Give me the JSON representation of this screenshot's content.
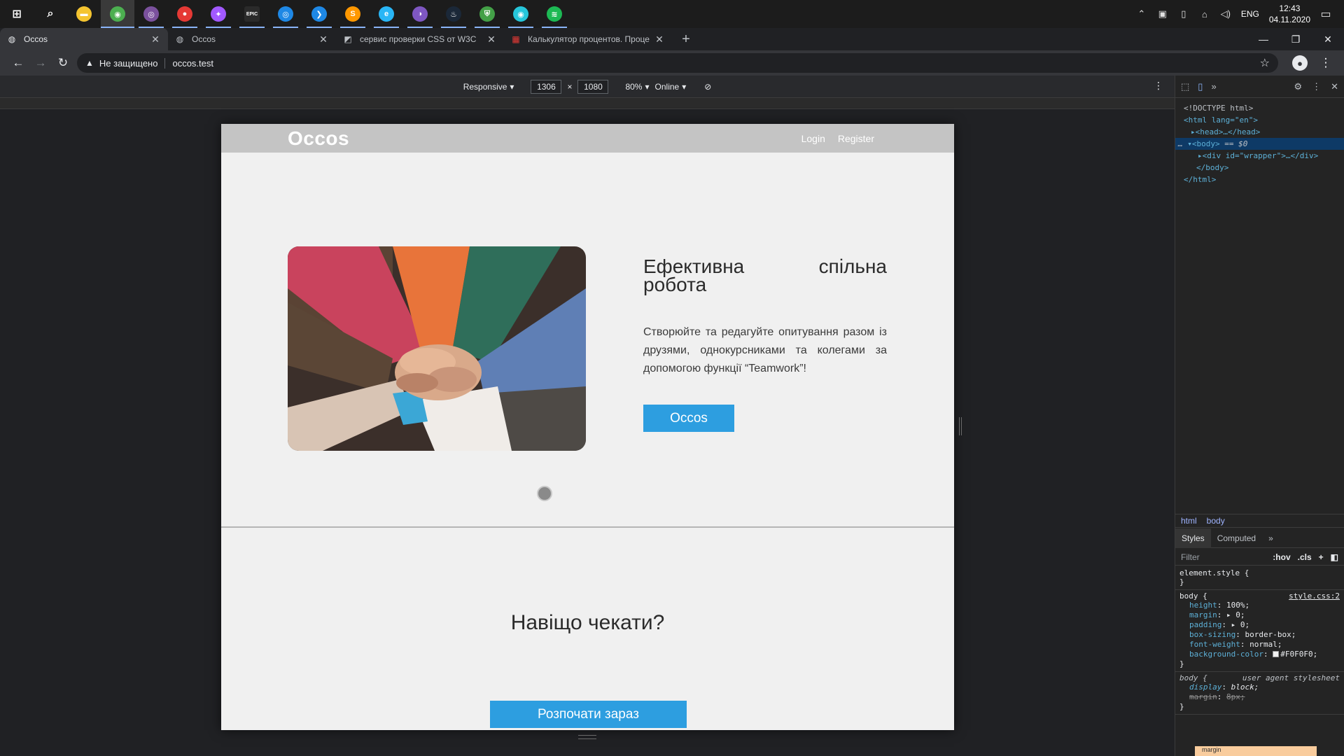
{
  "taskbar": {
    "apps": [
      {
        "name": "windows-start-icon",
        "glyph": "⊞",
        "color": "#ffffff"
      },
      {
        "name": "search-icon",
        "glyph": "⌕",
        "color": "#ffffff"
      },
      {
        "name": "file-explorer-icon",
        "glyph": "▬",
        "color": "#f4c430"
      },
      {
        "name": "chrome-icon",
        "glyph": "◉",
        "color": "#4caf50"
      },
      {
        "name": "viber-icon",
        "glyph": "◎",
        "color": "#7b519d"
      },
      {
        "name": "colorful-app-icon",
        "glyph": "●",
        "color": "#e53935"
      },
      {
        "name": "figma-icon",
        "glyph": "✦",
        "color": "#a259ff"
      },
      {
        "name": "epic-games-icon",
        "glyph": "EPIC",
        "color": "#2a2a2a"
      },
      {
        "name": "app-swirl-icon",
        "glyph": "◎",
        "color": "#1e88e5"
      },
      {
        "name": "vscode-icon",
        "glyph": "❯",
        "color": "#1e88e5"
      },
      {
        "name": "sublime-text-icon",
        "glyph": "S",
        "color": "#ff9800"
      },
      {
        "name": "edge-icon",
        "glyph": "e",
        "color": "#29b6f6"
      },
      {
        "name": "tor-browser-icon",
        "glyph": "◑",
        "color": "#7e57c2"
      },
      {
        "name": "steam-icon",
        "glyph": "♨",
        "color": "#1b2838"
      },
      {
        "name": "shield-vpn-icon",
        "glyph": "⛨",
        "color": "#43a047"
      },
      {
        "name": "app-cyan-icon",
        "glyph": "◉",
        "color": "#26c6da"
      },
      {
        "name": "spotify-icon",
        "glyph": "≋",
        "color": "#1db954"
      }
    ],
    "tray": {
      "lang": "ENG",
      "time": "12:43",
      "date": "04.11.2020"
    }
  },
  "browser": {
    "tabs": [
      {
        "title": "Occos",
        "fav": "◍",
        "active": true
      },
      {
        "title": "Occos",
        "fav": "◍",
        "active": false
      },
      {
        "title": "сервис проверки CSS от W3C",
        "fav": "◩",
        "active": false
      },
      {
        "title": "Калькулятор процентов. Проце",
        "fav": "▦",
        "active": false
      }
    ],
    "address": {
      "security_label": "Не защищено",
      "url": "occos.test"
    }
  },
  "device_toolbar": {
    "device": "Responsive",
    "width": "1306",
    "height": "1080",
    "zoom": "80%",
    "throttle": "Online"
  },
  "site": {
    "logo": "Occos",
    "nav": {
      "login": "Login",
      "register": "Register"
    },
    "hero": {
      "title_word1": "Ефективна",
      "title_word2": "спільна",
      "title_word3": "робота",
      "description": "Створюйте та редагуйте опитування разом із друзями, однокурсниками та колегами за допомогою функції “Teamwork”!",
      "button": "Occos"
    },
    "cta": {
      "title": "Навіщо чекати?",
      "button": "Розпочати зараз"
    }
  },
  "devtools": {
    "dom": {
      "doctype": "<!DOCTYPE html>",
      "html_open": "<html lang=\"en\">",
      "head": "<head>…</head>",
      "body_open": "<body>",
      "body_eq": "== $0",
      "div": "<div id=\"wrapper\">…</div>",
      "body_close": "</body>",
      "html_close": "</html>"
    },
    "breadcrumbs": [
      "html",
      "body"
    ],
    "panel_tabs": {
      "styles": "Styles",
      "computed": "Computed"
    },
    "filter_placeholder": "Filter",
    "filter_tools": {
      "hov": ":hov",
      "cls": ".cls"
    },
    "rules": {
      "element_style": "element.style {",
      "body_selector": "body {",
      "body_source": "style.css:2",
      "ua_selector": "body {",
      "ua_source": "user agent stylesheet",
      "close": "}",
      "props": [
        {
          "n": "height",
          "v": "100%;"
        },
        {
          "n": "margin",
          "v": "▸ 0;"
        },
        {
          "n": "padding",
          "v": "▸ 0;"
        },
        {
          "n": "box-sizing",
          "v": "border-box;"
        },
        {
          "n": "font-weight",
          "v": "normal;"
        },
        {
          "n": "background-color",
          "v": "#F0F0F0;"
        }
      ],
      "ua_props": [
        {
          "n": "display",
          "v": "block;"
        },
        {
          "n": "margin",
          "v": "8px;"
        }
      ]
    },
    "box_model_label": "margin"
  },
  "colors": {
    "accent": "#2d9ee0",
    "header": "#c4c4c4",
    "page_bg": "#f0f0f0"
  }
}
